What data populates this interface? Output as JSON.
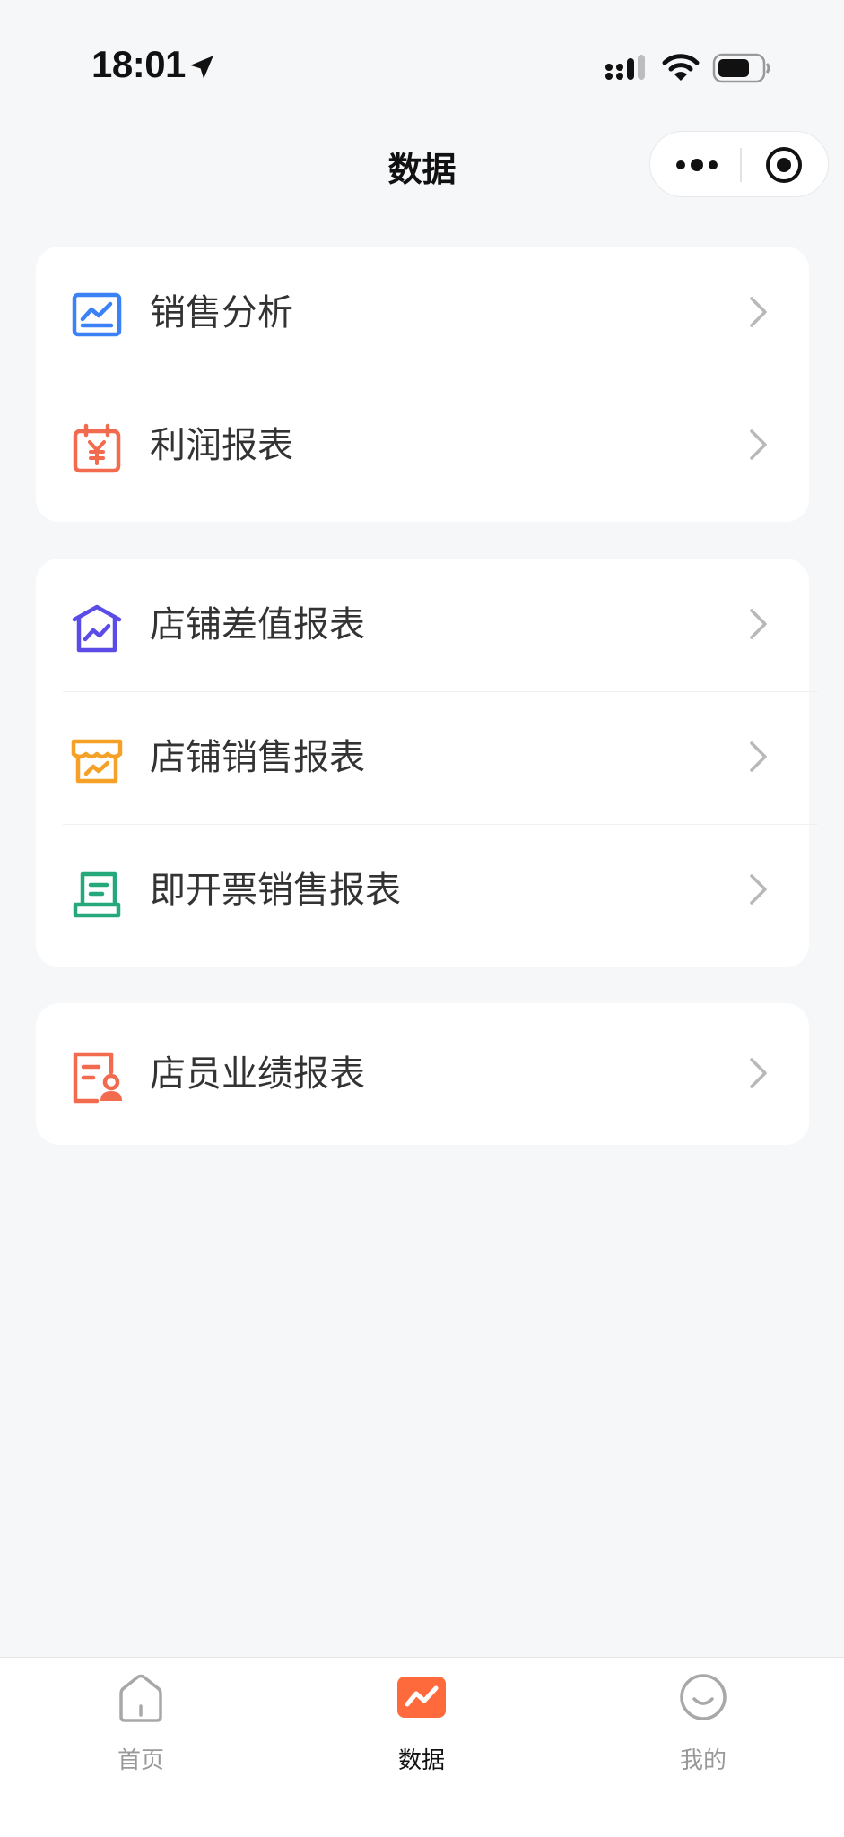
{
  "status_bar": {
    "time": "18:01"
  },
  "nav": {
    "title": "数据"
  },
  "groups": [
    {
      "items": [
        {
          "label": "销售分析",
          "icon": "sales-analysis-icon",
          "color": "#3B82F6"
        },
        {
          "label": "利润报表",
          "icon": "profit-calendar-yen-icon",
          "color": "#F26B4F"
        }
      ]
    },
    {
      "items": [
        {
          "label": "店铺差值报表",
          "icon": "store-difference-icon",
          "color": "#5B4CE8"
        },
        {
          "label": "店铺销售报表",
          "icon": "store-sales-icon",
          "color": "#F5A128"
        },
        {
          "label": "即开票销售报表",
          "icon": "instant-ticket-icon",
          "color": "#26A97A"
        }
      ]
    },
    {
      "items": [
        {
          "label": "店员业绩报表",
          "icon": "clerk-performance-icon",
          "color": "#F26B4F"
        }
      ]
    }
  ],
  "tabbar": {
    "accent": "#FF6A3D",
    "tabs": [
      {
        "label": "首页",
        "icon": "home-icon",
        "active": false
      },
      {
        "label": "数据",
        "icon": "data-chart-icon",
        "active": true
      },
      {
        "label": "我的",
        "icon": "smile-profile-icon",
        "active": false
      }
    ]
  }
}
